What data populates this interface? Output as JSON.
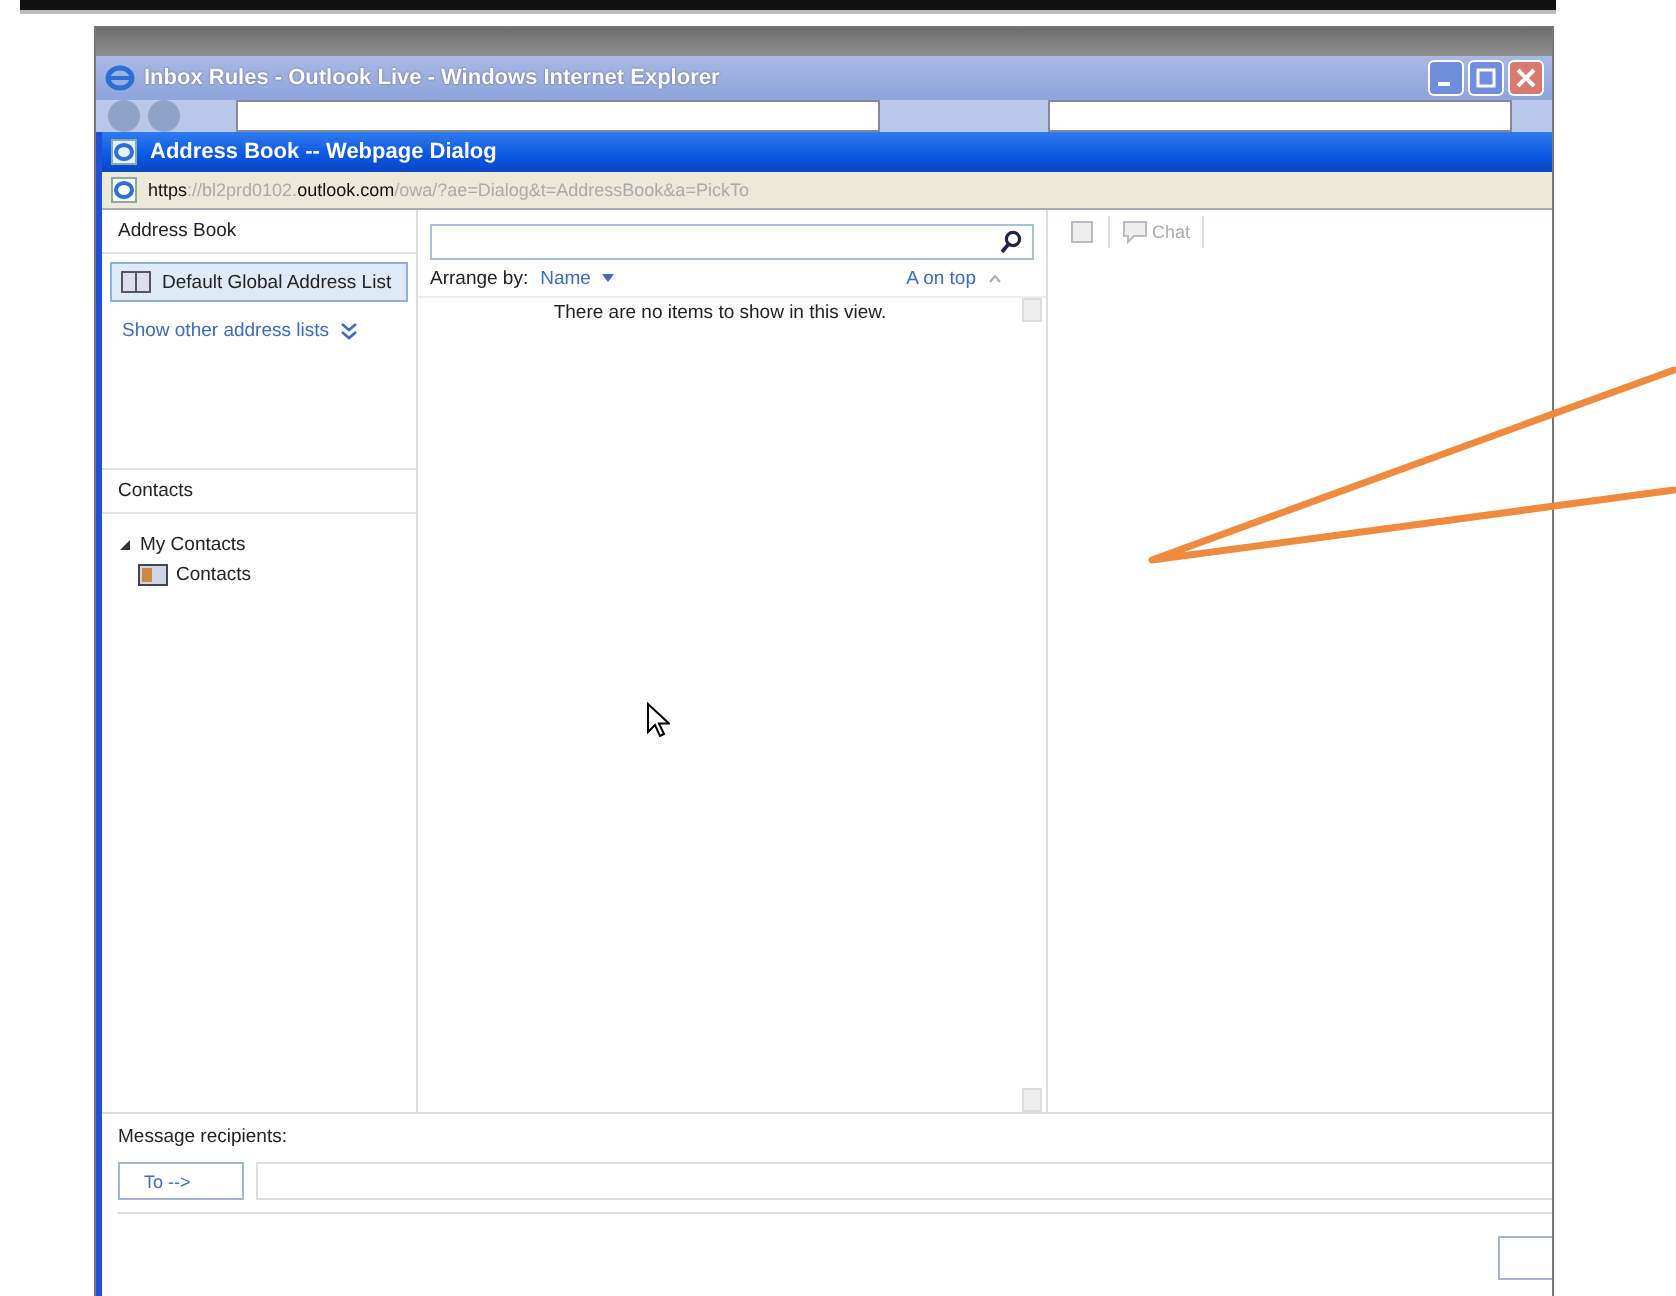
{
  "browser_window": {
    "title": "Inbox Rules - Outlook Live - Windows Internet Explorer"
  },
  "dialog": {
    "title": "Address Book -- Webpage Dialog",
    "url": "**https**://bl2prd0102.**outlook.com**/owa/?ae=Dialog&t=AddressBook&a=PickTo"
  },
  "address_book": {
    "heading": "Address Book",
    "list": "Default Global Address List",
    "list_selected": true,
    "more_link": "Show other address lists"
  },
  "contacts": {
    "heading": "Contacts",
    "tree": [
      {
        "label": "My Contacts",
        "expanded": true,
        "children": [
          {
            "label": "Contacts"
          }
        ]
      }
    ]
  },
  "results": {
    "arrange_label": "Arrange by:",
    "arrange_value": "Name",
    "order": "A on top",
    "empty_text": "There are no items to show in this view."
  },
  "details_toolbar": {
    "chat": "Chat"
  },
  "recipients": {
    "label": "Message recipients:",
    "to_button": "To -->"
  }
}
